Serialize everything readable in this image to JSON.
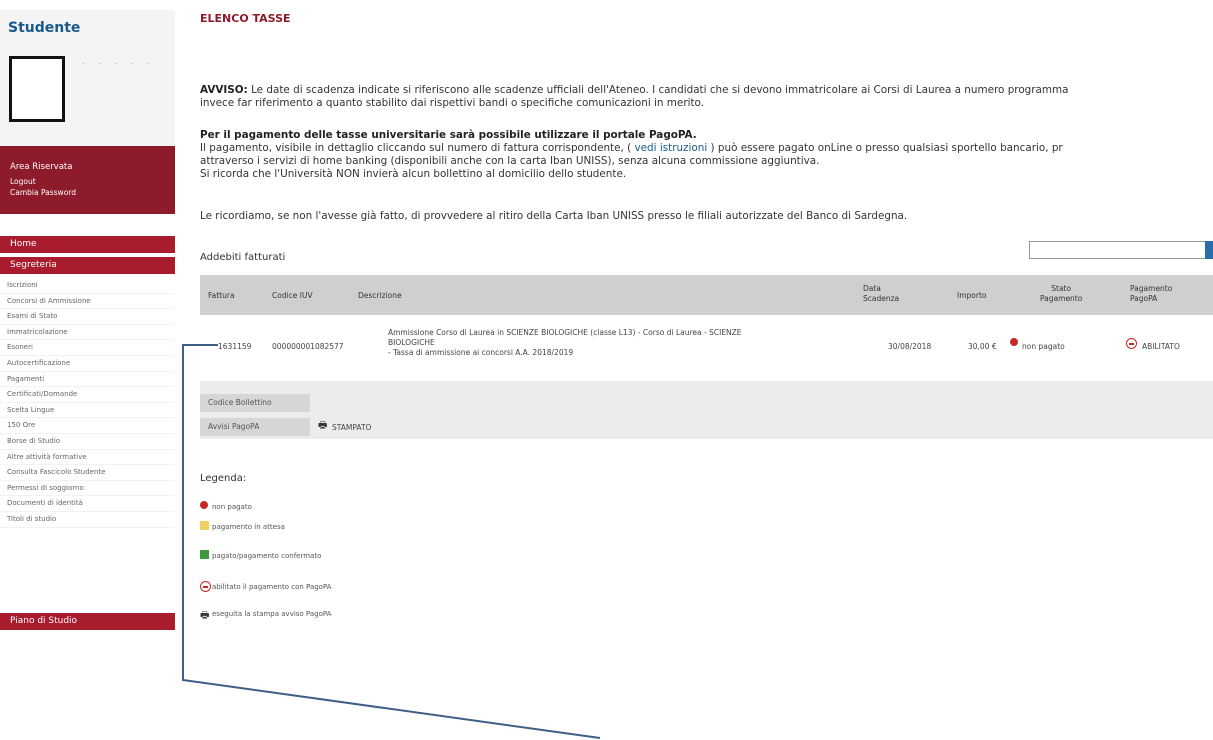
{
  "sidebar": {
    "title": "Studente",
    "photo_name": "· · · · ·",
    "area_title": "Area Riservata",
    "logout": "Logout",
    "change_password": "Cambia Password",
    "home": "Home",
    "segreteria": "Segreteria",
    "items": [
      "Iscrizioni",
      "Concorsi di Ammissione",
      "Esami di Stato",
      "Immatricolazione",
      "Esoneri",
      "Autocertificazione",
      "Pagamenti",
      "Certificati/Domande",
      "Scelta Lingue",
      "150 Ore",
      "Borse di Studio",
      "Altre attività formative",
      "Consulta Fascicolo Studente",
      "Permessi di soggiorno",
      "Documenti di identità",
      "Titoli di studio"
    ],
    "piano": "Piano di Studio"
  },
  "main": {
    "title": "ELENCO TASSE",
    "avviso_label": "AVVISO:",
    "avviso_line1": " Le date di scadenza indicate si riferiscono alle scadenze ufficiali dell'Ateneo. I candidati che si devono immatricolare ai Corsi di Laurea a numero programma",
    "avviso_line2": "invece far riferimento a quanto stabilito dai rispettivi bandi o specifiche comunicazioni in merito.",
    "pagopa_bold": "Per il pagamento delle tasse universitarie sarà possibile utilizzare il portale PagoPA.",
    "pagopa_line1a": "Il pagamento, visibile in dettaglio cliccando sul numero di fattura corrispondente, (",
    "pagopa_link": " vedi istruzioni ",
    "pagopa_line1b": ") può essere pagato onLine o presso qualsiasi sportello bancario, pr",
    "pagopa_line2": "attraverso i servizi di home banking (disponibili anche con la carta Iban UNISS), senza alcuna commissione aggiuntiva.",
    "pagopa_line3": "Si ricorda che l'Università NON invierà alcun bollettino al domicilio dello studente.",
    "ricordiamo": "Le ricordiamo, se non l'avesse già fatto, di provvedere al ritiro della Carta Iban UNISS presso le filiali autorizzate del Banco di Sardegna.",
    "addebiti": "Addebiti fatturati"
  },
  "table": {
    "headers": {
      "fattura": "Fattura",
      "iuv": "Codice IUV",
      "descrizione": "Descrizione",
      "scadenza_1": "Data",
      "scadenza_2": "Scadenza",
      "importo": "Importo",
      "stato_1": "Stato",
      "stato_2": "Pagamento",
      "pagopa_1": "Pagamento",
      "pagopa_2": "PagoPA"
    },
    "row": {
      "fattura": "1631159",
      "iuv": "000000001082577",
      "desc_1": "Ammissione Corso di Laurea in SCIENZE BIOLOGICHE (classe L13) - Corso di Laurea - SCIENZE",
      "desc_2": "BIOLOGICHE",
      "desc_3": "- Tassa di ammissione ai concorsi A.A. 2018/2019",
      "scadenza": "30/08/2018",
      "importo": "30,00 €",
      "stato": "non pagato",
      "pagopa": "ABILITATO"
    },
    "codice_bollettino": "Codice Bollettino",
    "avvisi_pagopa": "Avvisi PagoPA",
    "stampato": "STAMPATO"
  },
  "legend": {
    "title": "Legenda:",
    "items": [
      "non pagato",
      "pagamento in attesa",
      "pagato/pagamento confermato",
      "abilitato il pagamento con PagoPA",
      "eseguita la stampa avviso PagoPA"
    ]
  },
  "colors": {
    "accent_dark_red": "#8e1b2b",
    "menu_red": "#a81c2e",
    "link_blue": "#1a5a8a",
    "annotation_line": "#3f5f86"
  }
}
